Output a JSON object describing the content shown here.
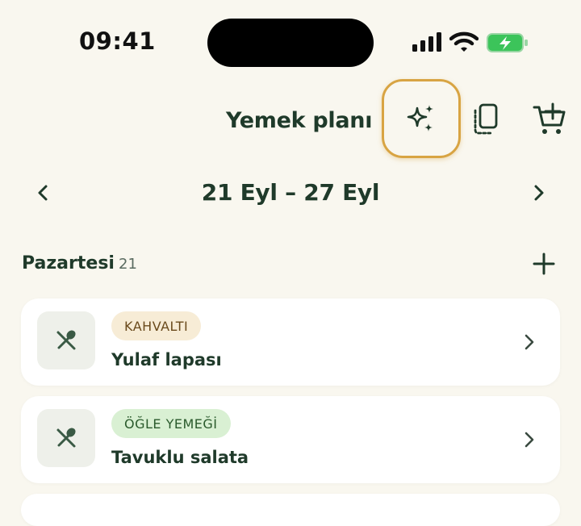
{
  "status_bar": {
    "time": "09:41"
  },
  "header": {
    "title": "Yemek planı",
    "icons": [
      "sparkle-icon",
      "copy-icon",
      "cart-add-icon"
    ],
    "accent_color": "#d8a443"
  },
  "week": {
    "range": "21 Eyl – 27 Eyl",
    "prev_icon": "chevron-left-icon",
    "next_icon": "chevron-right-icon"
  },
  "day": {
    "name": "Pazartesi",
    "number": "21"
  },
  "meals": [
    {
      "type": "KAHVALTI",
      "name": "Yulaf lapası",
      "badge_color": "#f7ecd6"
    },
    {
      "type": "ÖĞLE YEMEĞİ",
      "name": "Tavuklu salata",
      "badge_color": "#d9f0d3"
    }
  ],
  "colors": {
    "background": "#f9f7ef",
    "text_primary": "#1f3a2a",
    "card": "#ffffff"
  }
}
